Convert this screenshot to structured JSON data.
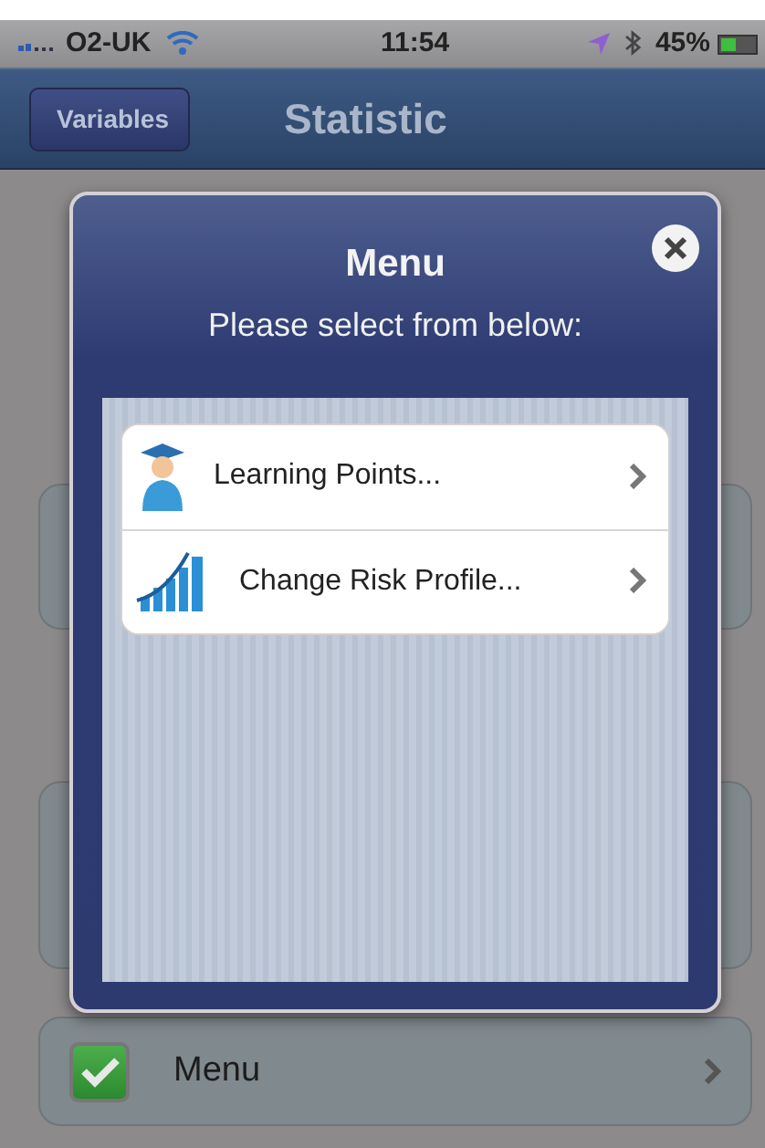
{
  "status_bar": {
    "carrier": "O2-UK",
    "time": "11:54",
    "battery": "45%"
  },
  "nav_bar": {
    "back": "Variables",
    "title": "Statistic"
  },
  "background_rows": [
    {
      "kind": "blank"
    },
    {
      "kind": "blank"
    },
    {
      "kind": "checkbox",
      "label": "Menu",
      "checked": true
    }
  ],
  "dialog": {
    "title": "Menu",
    "subtitle": "Please select from below:",
    "items": [
      {
        "kind": "graduate",
        "label": "Learning Points..."
      },
      {
        "kind": "chart",
        "label": "Change Risk Profile..."
      }
    ]
  }
}
